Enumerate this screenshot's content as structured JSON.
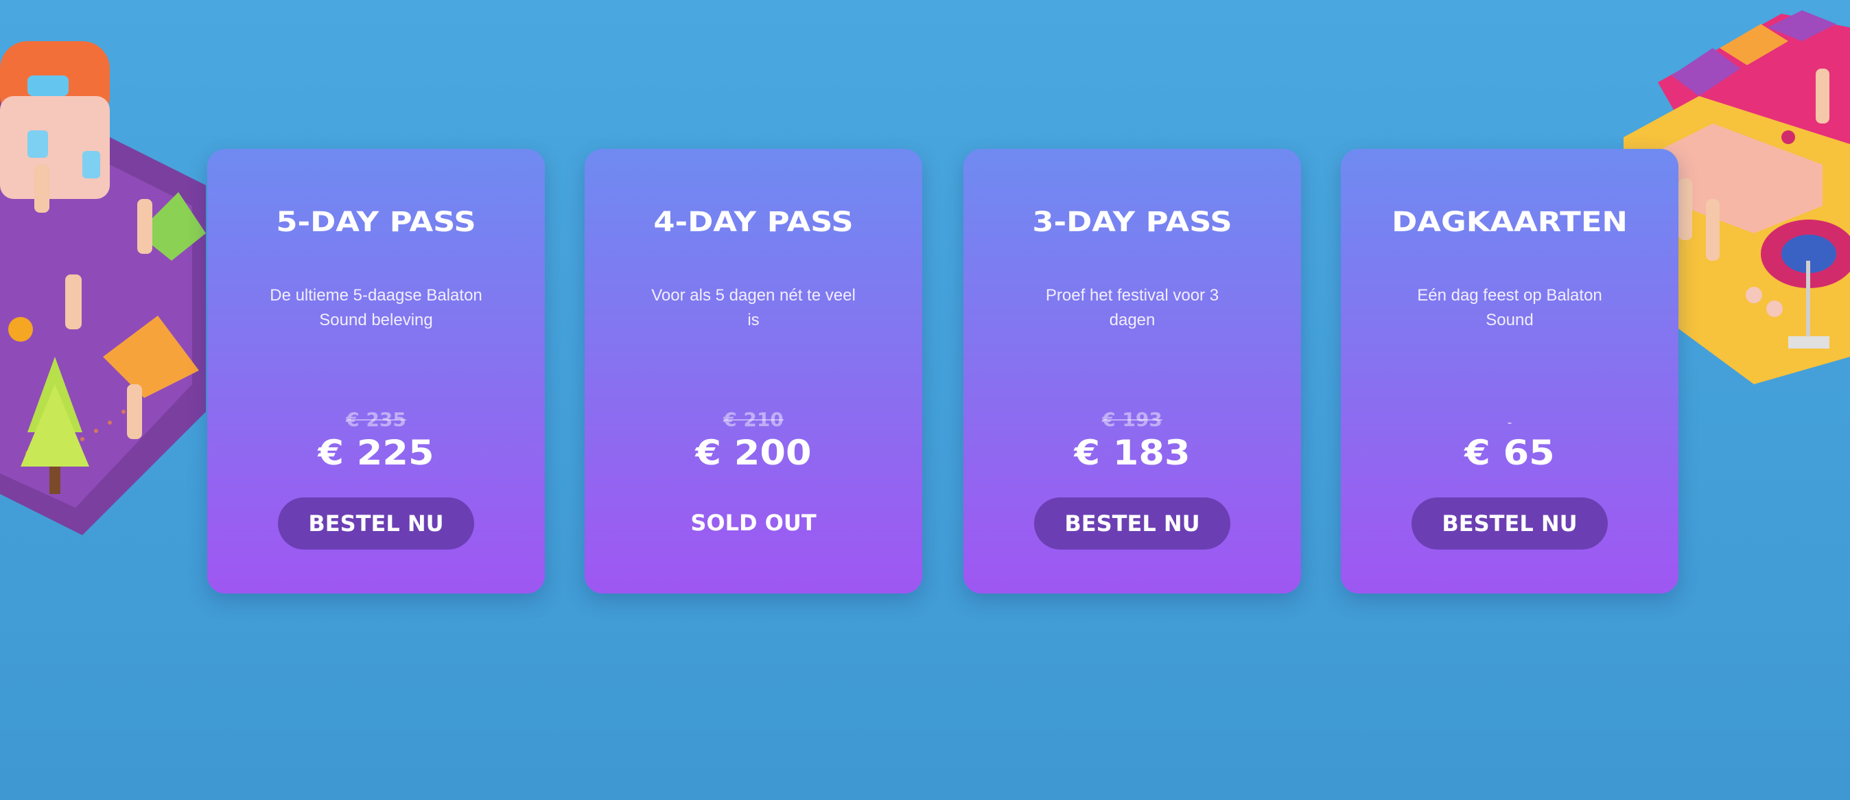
{
  "passes": [
    {
      "title": "5-DAY PASS",
      "description": "De ultieme 5-daagse Balaton Sound beleving",
      "old_price": "€ 235",
      "price": "€ 225",
      "action": "BESTEL NU"
    },
    {
      "title": "4-DAY PASS",
      "description": "Voor als 5 dagen nét te veel is",
      "old_price": "€ 210",
      "price": "€ 200",
      "status": "SOLD OUT"
    },
    {
      "title": "3-DAY PASS",
      "description": "Proef het festival voor 3 dagen",
      "old_price": "€ 193",
      "price": "€ 183",
      "action": "BESTEL NU"
    },
    {
      "title": "DAGKAARTEN",
      "description": "Eén dag feest op Balaton Sound",
      "old_price": "-",
      "price": "€ 65",
      "action": "BESTEL NU"
    }
  ],
  "colors": {
    "background": "#4aa7df",
    "card_top": "#6f8bf1",
    "card_bottom": "#9f57f2",
    "button": "#6b3fb3"
  }
}
